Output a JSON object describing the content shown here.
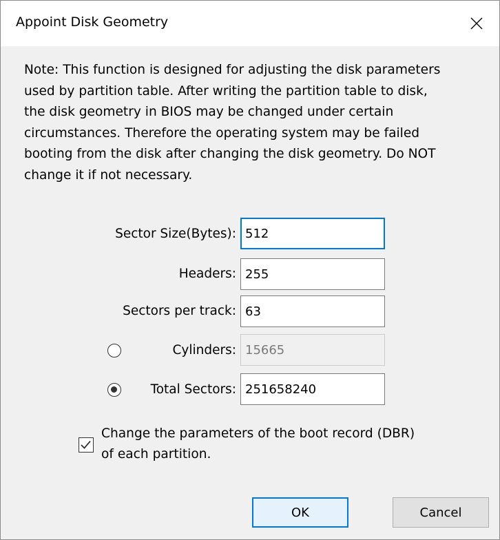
{
  "dialog": {
    "title": "Appoint Disk Geometry",
    "close_icon": "close-icon"
  },
  "note": {
    "lines": [
      "Note: This function is designed for adjusting the disk parameters",
      "used by partition table. After writing the partition table to disk,",
      "the disk geometry in BIOS may be changed under certain",
      "circumstances. Therefore the operating system may be failed",
      "booting from the disk after changing the disk geometry. Do NOT",
      "change it if not necessary."
    ]
  },
  "fields": {
    "sector_size": {
      "label": "Sector Size(Bytes):",
      "value": "512"
    },
    "headers": {
      "label": "Headers:",
      "value": "255"
    },
    "sectors_per_track": {
      "label": "Sectors per track:",
      "value": "63"
    },
    "cylinders": {
      "label": "Cylinders:",
      "value": "15665",
      "selected": false,
      "enabled": false
    },
    "total_sectors": {
      "label": "Total Sectors:",
      "value": "251658240",
      "selected": true,
      "enabled": true
    }
  },
  "change_dbr": {
    "checked": true,
    "label_lines": [
      "Change the parameters of the boot record (DBR)",
      "of each partition."
    ]
  },
  "buttons": {
    "ok": "OK",
    "cancel": "Cancel"
  },
  "colors": {
    "accent": "#0078d7",
    "dialog_bg": "#f0f0f0",
    "titlebar_bg": "#ffffff"
  }
}
